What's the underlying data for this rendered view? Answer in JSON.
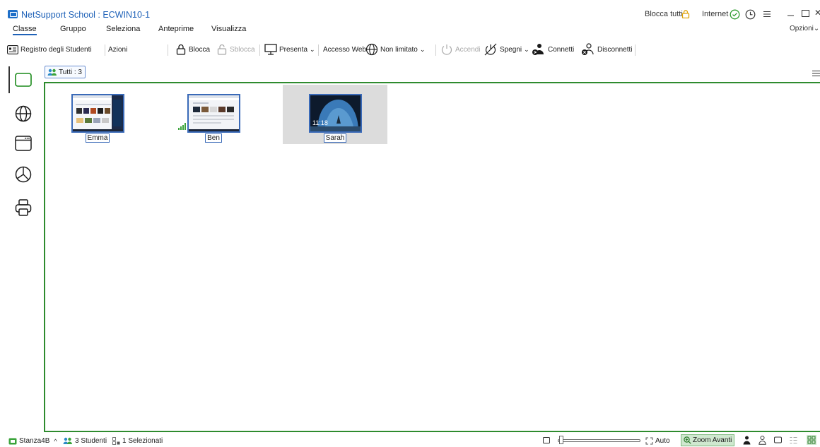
{
  "window": {
    "title": "NetSupport School : ECWIN10-1",
    "blocca_tutti": "Blocca tutti",
    "internet_label": "Internet"
  },
  "menu": {
    "items": [
      "Classe",
      "Gruppo",
      "Seleziona",
      "Anteprime",
      "Visualizza"
    ],
    "options": "Opzioni"
  },
  "toolbar": {
    "registro": "Registro degli Studenti",
    "azioni": "Azioni",
    "blocca": "Blocca",
    "sblocca": "Sblocca",
    "presenta": "Presenta",
    "accesso_web": "Accesso Web",
    "non_limitato": "Non limitato",
    "accendi": "Accendi",
    "spegni": "Spegni",
    "connetti": "Connetti",
    "disconnetti": "Disconnetti"
  },
  "tabs": {
    "tutti": "Tutti : 3"
  },
  "students": [
    {
      "name": "Emma",
      "selected": false,
      "theme": "browser-dark"
    },
    {
      "name": "Ben",
      "selected": false,
      "theme": "browser-light"
    },
    {
      "name": "Sarah",
      "selected": true,
      "theme": "lockscreen",
      "clock": "11:18"
    }
  ],
  "statusbar": {
    "room": "Stanza4B",
    "students": "3 Studenti",
    "selected": "1 Selezionati",
    "auto": "Auto",
    "zoom": "Zoom Avanti"
  },
  "colors": {
    "accent": "#1f62b8",
    "panel_border": "#2e8b2e",
    "selected_bg": "#dcdcdc",
    "zoom_bg": "#cfe8cf"
  }
}
